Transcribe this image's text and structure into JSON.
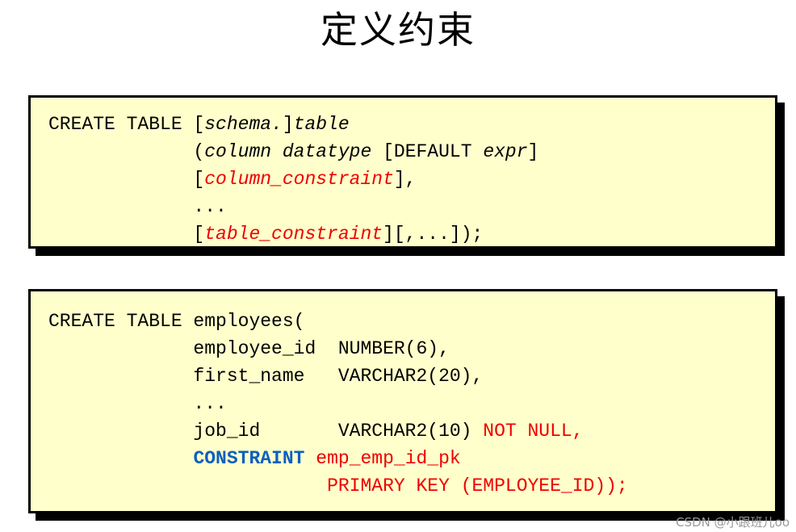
{
  "slide": {
    "title": "定义约束",
    "watermark": "CSDN @小跟班儿oo",
    "colors": {
      "box_background": "#FFFFCC",
      "box_border": "#000000",
      "keyword_red": "#EE0000",
      "keyword_blue": "#0D5FBF",
      "page_background": "#FFFFFF"
    }
  },
  "syntax_box": {
    "lines": [
      {
        "tokens": [
          {
            "text": "CREATE TABLE ",
            "style": "plain"
          },
          {
            "text": "[",
            "style": "plain"
          },
          {
            "text": "schema.",
            "style": "italic"
          },
          {
            "text": "]",
            "style": "plain"
          },
          {
            "text": "table",
            "style": "italic"
          }
        ]
      },
      {
        "tokens": [
          {
            "text": "             (",
            "style": "plain"
          },
          {
            "text": "column datatype",
            "style": "italic"
          },
          {
            "text": " [DEFAULT ",
            "style": "plain"
          },
          {
            "text": "expr",
            "style": "italic"
          },
          {
            "text": "]",
            "style": "plain"
          }
        ]
      },
      {
        "tokens": [
          {
            "text": "             [",
            "style": "plain"
          },
          {
            "text": "column_constraint",
            "style": "red-italic"
          },
          {
            "text": "],",
            "style": "plain"
          }
        ]
      },
      {
        "tokens": [
          {
            "text": "             ...",
            "style": "plain"
          }
        ]
      },
      {
        "tokens": [
          {
            "text": "             [",
            "style": "plain"
          },
          {
            "text": "table_constraint",
            "style": "red-italic"
          },
          {
            "text": "][,...]);",
            "style": "plain"
          }
        ]
      }
    ]
  },
  "example_box": {
    "lines": [
      {
        "tokens": [
          {
            "text": "CREATE TABLE employees(",
            "style": "plain"
          }
        ]
      },
      {
        "tokens": [
          {
            "text": "             employee_id  NUMBER(6),",
            "style": "plain"
          }
        ]
      },
      {
        "tokens": [
          {
            "text": "             first_name   VARCHAR2(20),",
            "style": "plain"
          }
        ]
      },
      {
        "tokens": [
          {
            "text": "             ...",
            "style": "plain"
          }
        ]
      },
      {
        "tokens": [
          {
            "text": "             job_id       VARCHAR2(10) ",
            "style": "plain"
          },
          {
            "text": "NOT NULL,",
            "style": "red"
          }
        ]
      },
      {
        "tokens": [
          {
            "text": "             ",
            "style": "plain"
          },
          {
            "text": "CONSTRAINT",
            "style": "blue-bold"
          },
          {
            "text": " ",
            "style": "plain"
          },
          {
            "text": "emp_emp_id_pk",
            "style": "red"
          }
        ]
      },
      {
        "tokens": [
          {
            "text": "                         ",
            "style": "plain"
          },
          {
            "text": "PRIMARY KEY (EMPLOYEE_ID));",
            "style": "red"
          }
        ]
      }
    ]
  }
}
